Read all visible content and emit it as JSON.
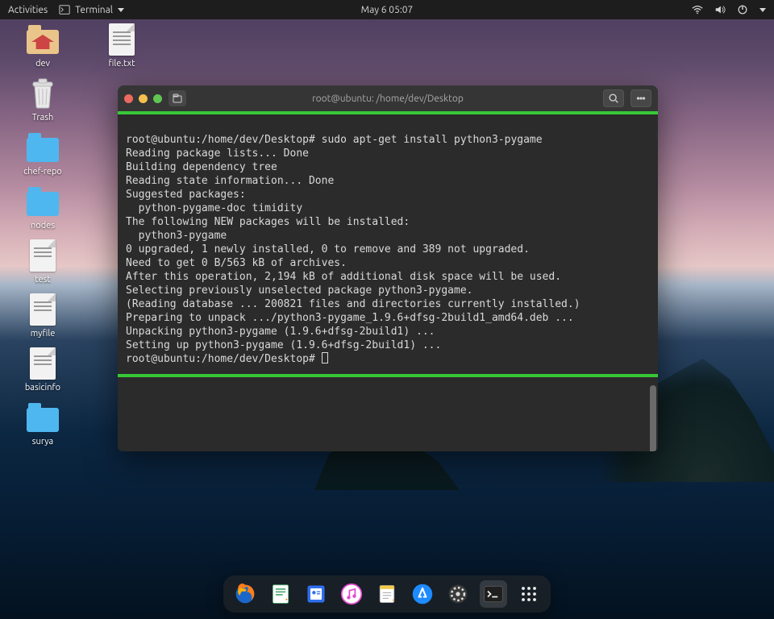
{
  "topbar": {
    "activities": "Activities",
    "app_name": "Terminal",
    "datetime": "May 6  05:07"
  },
  "desktop_icons": [
    {
      "kind": "home-folder",
      "label": "dev"
    },
    {
      "kind": "file",
      "label": "file.txt"
    },
    {
      "kind": "trash",
      "label": "Trash"
    },
    {
      "kind": "folder",
      "label": "chef-repo"
    },
    {
      "kind": "folder",
      "label": "nodes"
    },
    {
      "kind": "file",
      "label": "test"
    },
    {
      "kind": "file",
      "label": "myfile"
    },
    {
      "kind": "file",
      "label": "basicinfo"
    },
    {
      "kind": "folder",
      "label": "surya"
    }
  ],
  "terminal": {
    "title": "root@ubuntu: /home/dev/Desktop",
    "prompt": "root@ubuntu:/home/dev/Desktop#",
    "command": "sudo apt-get install python3-pygame",
    "output_lines": [
      "Reading package lists... Done",
      "Building dependency tree",
      "Reading state information... Done",
      "Suggested packages:",
      "  python-pygame-doc timidity",
      "The following NEW packages will be installed:",
      "  python3-pygame",
      "0 upgraded, 1 newly installed, 0 to remove and 389 not upgraded.",
      "Need to get 0 B/563 kB of archives.",
      "After this operation, 2,194 kB of additional disk space will be used.",
      "Selecting previously unselected package python3-pygame.",
      "(Reading database ... 200821 files and directories currently installed.)",
      "Preparing to unpack .../python3-pygame_1.9.6+dfsg-2build1_amd64.deb ...",
      "Unpacking python3-pygame (1.9.6+dfsg-2build1) ...",
      "Setting up python3-pygame (1.9.6+dfsg-2build1) ..."
    ],
    "prompt2": "root@ubuntu:/home/dev/Desktop#"
  },
  "dock_items": [
    "firefox",
    "text-editor",
    "files",
    "music",
    "notes",
    "app-store",
    "settings",
    "terminal",
    "app-grid"
  ]
}
